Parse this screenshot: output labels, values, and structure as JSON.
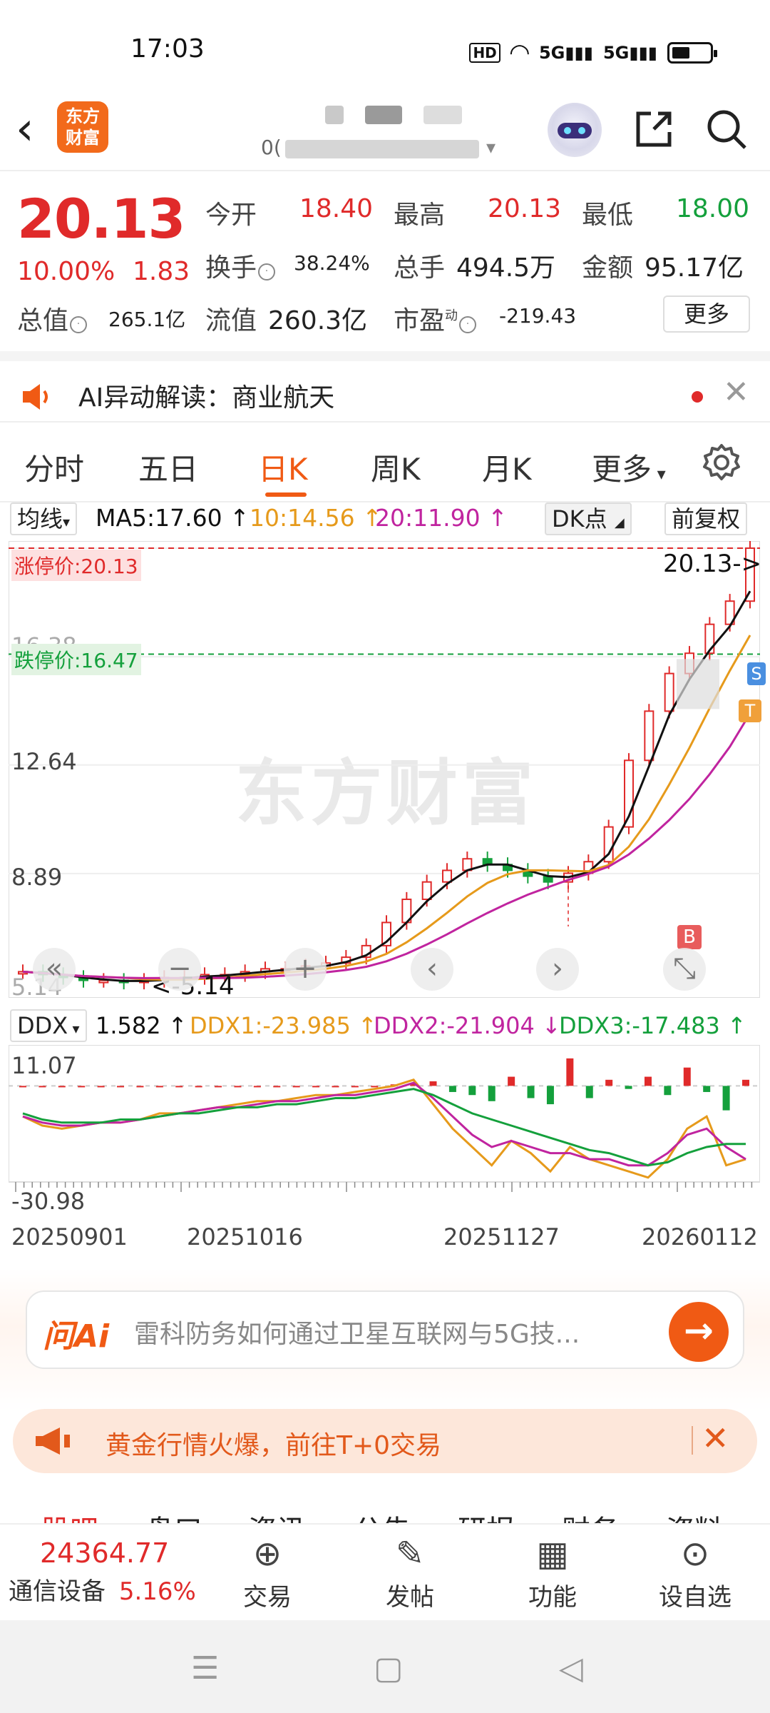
{
  "status_bar": {
    "time": "17:03",
    "hd": "HD",
    "sig1": "5G",
    "sig2": "5G"
  },
  "nav": {
    "logo_line1": "东方",
    "logo_line2": "财富",
    "code_prefix": "0("
  },
  "quote": {
    "price": "20.13",
    "change_pct": "10.00%",
    "change": "1.83",
    "open_label": "今开",
    "open": "18.40",
    "high_label": "最高",
    "high": "20.13",
    "low_label": "最低",
    "low": "18.00",
    "turnover_label": "换手",
    "turnover": "38.24%",
    "volume_label": "总手",
    "volume": "494.5万",
    "amount_label": "金额",
    "amount": "95.17亿",
    "mktcap_label": "总值",
    "mktcap": "265.1亿",
    "float_label": "流值",
    "float": "260.3亿",
    "pe_label": "市盈",
    "pe_sup": "动",
    "pe": "-219.43",
    "more": "更多"
  },
  "ai_bar": {
    "text": "AI异动解读：商业航天"
  },
  "tabs": [
    "分时",
    "五日",
    "日K",
    "周K",
    "月K",
    "更多"
  ],
  "ma_row": {
    "selector": "均线",
    "ma5": "MA5:17.60",
    "ma10": "10:14.56",
    "ma20": "20:11.90",
    "dk": "DK点",
    "fq": "前复权"
  },
  "kline": {
    "limit_up": "涨停价:20.13",
    "limit_down": "跌停价:16.47",
    "last_label": "20.13->",
    "low_label": "<-5.14",
    "axis": [
      "16.38",
      "12.64",
      "8.89",
      "5.14"
    ],
    "watermark": "东方财富",
    "marker_b": "B",
    "marker_s": "S",
    "marker_t": "T",
    "btns": [
      "«",
      "−",
      "+",
      "‹",
      "›",
      "⤡"
    ]
  },
  "ddx_row": {
    "selector": "DDX",
    "ddx": "1.582",
    "ddx1": "DDX1:-23.985",
    "ddx2": "DDX2:-21.904",
    "ddx3": "DDX3:-17.483"
  },
  "ddx_axis": {
    "top": "11.07",
    "bottom": "-30.98"
  },
  "dates": [
    "20250901",
    "20251016",
    "20251127",
    "20260112"
  ],
  "chart_data": {
    "type": "candlestick",
    "ylim": [
      5.14,
      20.13
    ],
    "x_dates": [
      "20250901",
      "20251016",
      "20251127",
      "20260112"
    ],
    "close_approx": [
      5.5,
      5.4,
      5.3,
      5.2,
      5.2,
      5.14,
      5.2,
      5.3,
      5.3,
      5.4,
      5.4,
      5.5,
      5.6,
      5.6,
      5.7,
      5.8,
      6.0,
      6.4,
      7.2,
      8.0,
      8.6,
      9.0,
      9.4,
      9.2,
      9.0,
      8.8,
      8.6,
      8.9,
      9.3,
      10.5,
      12.8,
      14.5,
      15.8,
      16.5,
      17.5,
      18.3,
      20.13
    ],
    "limit_up": 20.13,
    "limit_down": 16.47,
    "ma5": 17.6,
    "ma10": 14.56,
    "ma20": 11.9,
    "ddx_range": [
      -30.98,
      11.07
    ]
  },
  "ask": {
    "logo": "问Ai",
    "text": "雷科防务如何通过卫星互联网与5G技..."
  },
  "promo": {
    "text": "黄金行情火爆，前往T+0交易"
  },
  "sub_tabs": [
    "股吧",
    "盘口",
    "资讯",
    "公告",
    "研报",
    "财务",
    "资料"
  ],
  "toolbar": {
    "index_value": "24364.77",
    "index_name": "通信设备",
    "index_pct": "5.16%",
    "items": [
      "交易",
      "发帖",
      "功能",
      "设自选"
    ]
  },
  "colors": {
    "up": "#e02a2a",
    "down": "#14a03c",
    "accent": "#f05a14",
    "ma5": "#111111",
    "ma10": "#e69a1b",
    "ma20": "#c0249f"
  }
}
